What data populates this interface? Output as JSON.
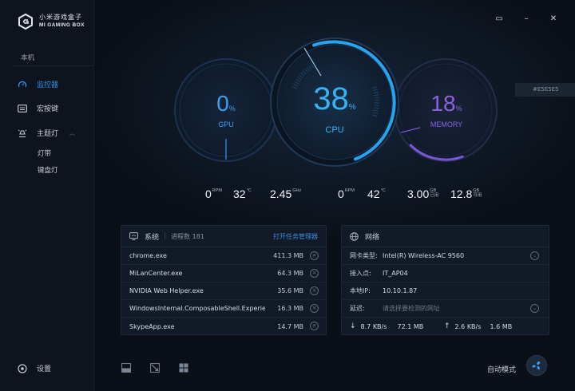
{
  "brand": {
    "cn": "小米游戏盒子",
    "en": "MI GAMING BOX"
  },
  "sidebar": {
    "section": "本机",
    "items": [
      {
        "label": "监控器",
        "icon": "gauge-icon",
        "active": true
      },
      {
        "label": "宏按键",
        "icon": "keyboard-icon",
        "active": false
      },
      {
        "label": "主题灯",
        "icon": "lamp-icon",
        "active": false
      }
    ],
    "sub_items": [
      "灯带",
      "键盘灯"
    ],
    "settings": "设置"
  },
  "window": {
    "minimize": "▭",
    "mini_dash": "–",
    "close": "✕"
  },
  "gauges": {
    "gpu": {
      "value": "0",
      "unit": "%",
      "label": "GPU",
      "percent": 0
    },
    "cpu": {
      "value": "38",
      "unit": "%",
      "label": "CPU",
      "percent": 38
    },
    "memory": {
      "value": "18",
      "unit": "%",
      "label": "MEMORY",
      "percent": 18
    }
  },
  "stats": {
    "gpu_fan": {
      "value": "0",
      "unit": "RPM"
    },
    "gpu_temp": {
      "value": "32",
      "unit": "°C"
    },
    "cpu_freq": {
      "value": "2.45",
      "unit": "GHz"
    },
    "cpu_fan": {
      "value": "0",
      "unit": "RPM"
    },
    "cpu_temp": {
      "value": "42",
      "unit": "°C"
    },
    "mem_used": {
      "value": "3.00",
      "unit1": "GB",
      "unit2": "已用"
    },
    "mem_free": {
      "value": "12.8",
      "unit1": "GB",
      "unit2": "可用"
    }
  },
  "side_tag": "#E5E5E5",
  "system_panel": {
    "title": "系统",
    "sub": "进程数 181",
    "link": "打开任务管理器",
    "processes": [
      {
        "name": "chrome.exe",
        "mem": "411.3 MB"
      },
      {
        "name": "MiLanCenter.exe",
        "mem": "64.3 MB"
      },
      {
        "name": "NVIDIA Web Helper.exe",
        "mem": "35.6 MB"
      },
      {
        "name": "WindowsInternal.ComposableShell.Experiences",
        "mem": "16.3 MB"
      },
      {
        "name": "SkypeApp.exe",
        "mem": "14.7 MB"
      }
    ],
    "close_glyph": "×"
  },
  "network_panel": {
    "title": "网络",
    "card_label": "网卡类型:",
    "card_value": "Intel(R) Wireless-AC 9560",
    "ap_label": "接入点:",
    "ap_value": "IT_AP04",
    "ip_label": "本地IP:",
    "ip_value": "10.10.1.87",
    "delay_label": "延迟:",
    "delay_placeholder": "请选择要检测的网址",
    "down_arrow": "↓",
    "down_speed": "8.7 KB/s",
    "down_total": "72.1 MB",
    "up_arrow": "↑",
    "up_speed": "2.6 KB/s",
    "up_total": "1.6 MB",
    "chevron": "⌄"
  },
  "bottom": {
    "auto_label": "自动模式"
  },
  "colors": {
    "accent": "#2f8de6",
    "cpu": "#27a3f0",
    "memory": "#7a55d8",
    "gpu": "#2b7fd4"
  }
}
